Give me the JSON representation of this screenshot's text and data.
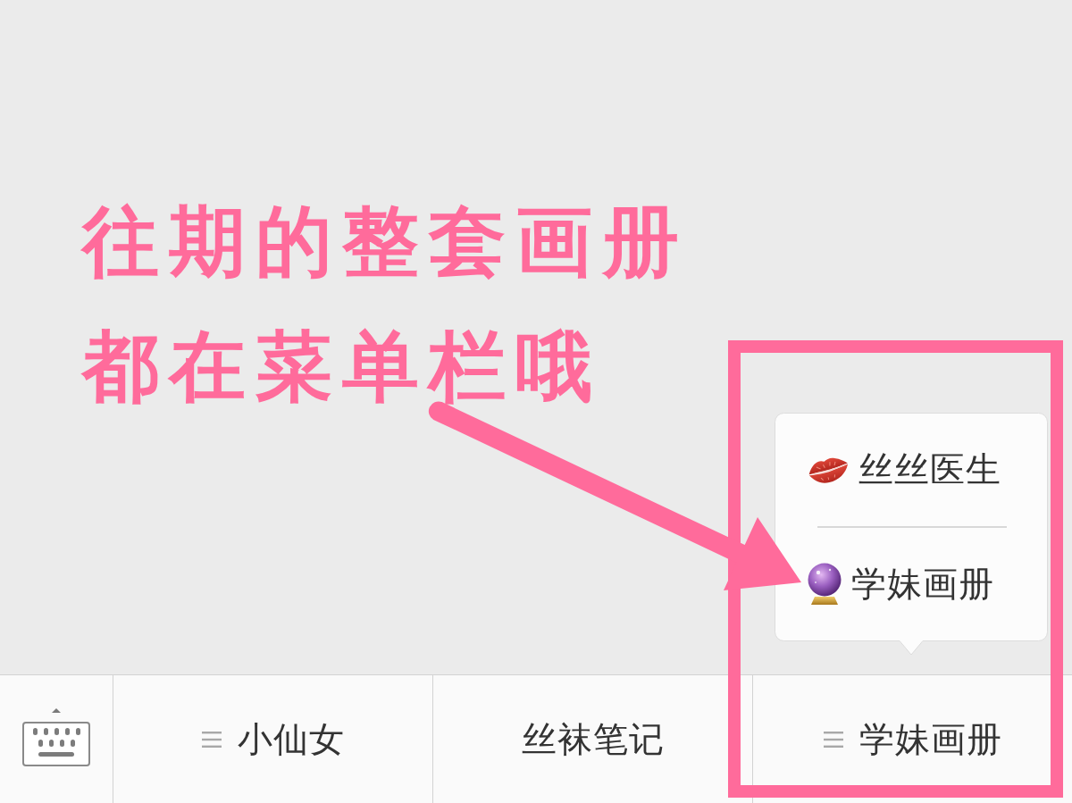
{
  "annotation": {
    "lines": [
      "往期的整套画册",
      "都在菜单栏哦"
    ]
  },
  "popup_menu": {
    "items": [
      {
        "label": "丝丝医生"
      },
      {
        "label": "学妹画册"
      }
    ]
  },
  "menu_bar": {
    "items": [
      {
        "label": "小仙女",
        "has_submenu": true
      },
      {
        "label": "丝袜笔记",
        "has_submenu": false
      },
      {
        "label": "学妹画册",
        "has_submenu": true
      }
    ]
  }
}
